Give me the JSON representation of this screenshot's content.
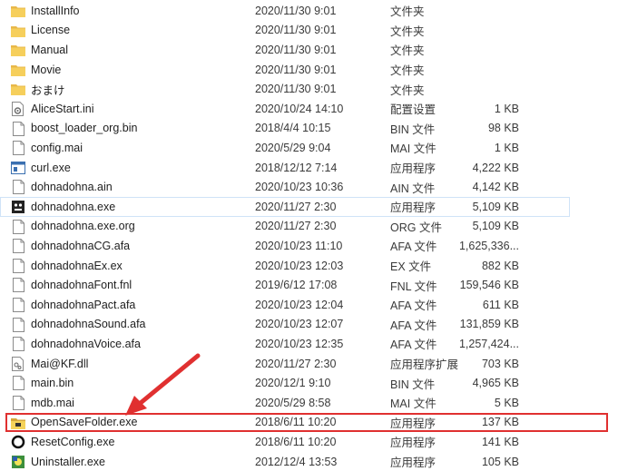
{
  "files": [
    {
      "name": "InstallInfo",
      "date": "2020/11/30 9:01",
      "type": "文件夹",
      "size": "",
      "icon": "folder-icon"
    },
    {
      "name": "License",
      "date": "2020/11/30 9:01",
      "type": "文件夹",
      "size": "",
      "icon": "folder-icon"
    },
    {
      "name": "Manual",
      "date": "2020/11/30 9:01",
      "type": "文件夹",
      "size": "",
      "icon": "folder-icon"
    },
    {
      "name": "Movie",
      "date": "2020/11/30 9:01",
      "type": "文件夹",
      "size": "",
      "icon": "folder-icon"
    },
    {
      "name": "おまけ",
      "date": "2020/11/30 9:01",
      "type": "文件夹",
      "size": "",
      "icon": "folder-icon"
    },
    {
      "name": "AliceStart.ini",
      "date": "2020/10/24 14:10",
      "type": "配置设置",
      "size": "1 KB",
      "icon": "ini-icon"
    },
    {
      "name": "boost_loader_org.bin",
      "date": "2018/4/4 10:15",
      "type": "BIN 文件",
      "size": "98 KB",
      "icon": "file-icon"
    },
    {
      "name": "config.mai",
      "date": "2020/5/29 9:04",
      "type": "MAI 文件",
      "size": "1 KB",
      "icon": "file-icon"
    },
    {
      "name": "curl.exe",
      "date": "2018/12/12 7:14",
      "type": "应用程序",
      "size": "4,222 KB",
      "icon": "exe-icon"
    },
    {
      "name": "dohnadohna.ain",
      "date": "2020/10/23 10:36",
      "type": "AIN 文件",
      "size": "4,142 KB",
      "icon": "file-icon"
    },
    {
      "name": "dohnadohna.exe",
      "date": "2020/11/27 2:30",
      "type": "应用程序",
      "size": "5,109 KB",
      "icon": "dohnadohna-icon"
    },
    {
      "name": "dohnadohna.exe.org",
      "date": "2020/11/27 2:30",
      "type": "ORG 文件",
      "size": "5,109 KB",
      "icon": "file-icon"
    },
    {
      "name": "dohnadohnaCG.afa",
      "date": "2020/10/23 11:10",
      "type": "AFA 文件",
      "size": "1,625,336...",
      "icon": "file-icon"
    },
    {
      "name": "dohnadohnaEx.ex",
      "date": "2020/10/23 12:03",
      "type": "EX 文件",
      "size": "882 KB",
      "icon": "file-icon"
    },
    {
      "name": "dohnadohnaFont.fnl",
      "date": "2019/6/12 17:08",
      "type": "FNL 文件",
      "size": "159,546 KB",
      "icon": "file-icon"
    },
    {
      "name": "dohnadohnaPact.afa",
      "date": "2020/10/23 12:04",
      "type": "AFA 文件",
      "size": "611 KB",
      "icon": "file-icon"
    },
    {
      "name": "dohnadohnaSound.afa",
      "date": "2020/10/23 12:07",
      "type": "AFA 文件",
      "size": "131,859 KB",
      "icon": "file-icon"
    },
    {
      "name": "dohnadohnaVoice.afa",
      "date": "2020/10/23 12:35",
      "type": "AFA 文件",
      "size": "1,257,424...",
      "icon": "file-icon"
    },
    {
      "name": "Mai@KF.dll",
      "date": "2020/11/27 2:30",
      "type": "应用程序扩展",
      "size": "703 KB",
      "icon": "dll-icon"
    },
    {
      "name": "main.bin",
      "date": "2020/12/1 9:10",
      "type": "BIN 文件",
      "size": "4,965 KB",
      "icon": "file-icon"
    },
    {
      "name": "mdb.mai",
      "date": "2020/5/29 8:58",
      "type": "MAI 文件",
      "size": "5 KB",
      "icon": "file-icon"
    },
    {
      "name": "OpenSaveFolder.exe",
      "date": "2018/6/11 10:20",
      "type": "应用程序",
      "size": "137 KB",
      "icon": "opensavefolder-icon"
    },
    {
      "name": "ResetConfig.exe",
      "date": "2018/6/11 10:20",
      "type": "应用程序",
      "size": "141 KB",
      "icon": "resetconfig-icon"
    },
    {
      "name": "Uninstaller.exe",
      "date": "2012/12/4 13:53",
      "type": "应用程序",
      "size": "105 KB",
      "icon": "uninstaller-icon"
    }
  ],
  "highlight_color": "#e03030"
}
